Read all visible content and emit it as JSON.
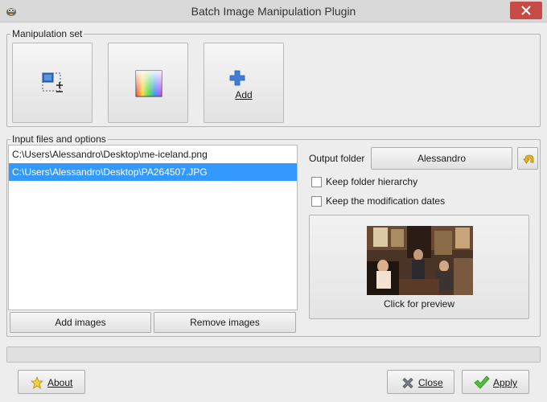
{
  "window": {
    "title": "Batch Image Manipulation Plugin"
  },
  "manipulation_set": {
    "label": "Manipulation set",
    "tools": [
      {
        "icon": "resize-icon"
      },
      {
        "icon": "color-palette-icon"
      },
      {
        "icon": "plus-icon",
        "label": "Add"
      }
    ]
  },
  "input": {
    "label": "Input files and options",
    "files": [
      {
        "path": "C:\\Users\\Alessandro\\Desktop\\me-iceland.png",
        "selected": false
      },
      {
        "path": "C:\\Users\\Alessandro\\Desktop\\PA264507.JPG",
        "selected": true
      }
    ],
    "add_images_label": "Add images",
    "remove_images_label": "Remove images",
    "output_folder_label": "Output folder",
    "output_folder_value": "Alessandro",
    "keep_hierarchy_label": "Keep folder hierarchy",
    "keep_hierarchy_checked": false,
    "keep_dates_label": "Keep the modification dates",
    "keep_dates_checked": false,
    "preview_caption": "Click for preview"
  },
  "footer": {
    "about_label": "About",
    "close_label": "Close",
    "apply_label": "Apply"
  },
  "colors": {
    "selection": "#3399ff",
    "close_button": "#c74b45"
  }
}
